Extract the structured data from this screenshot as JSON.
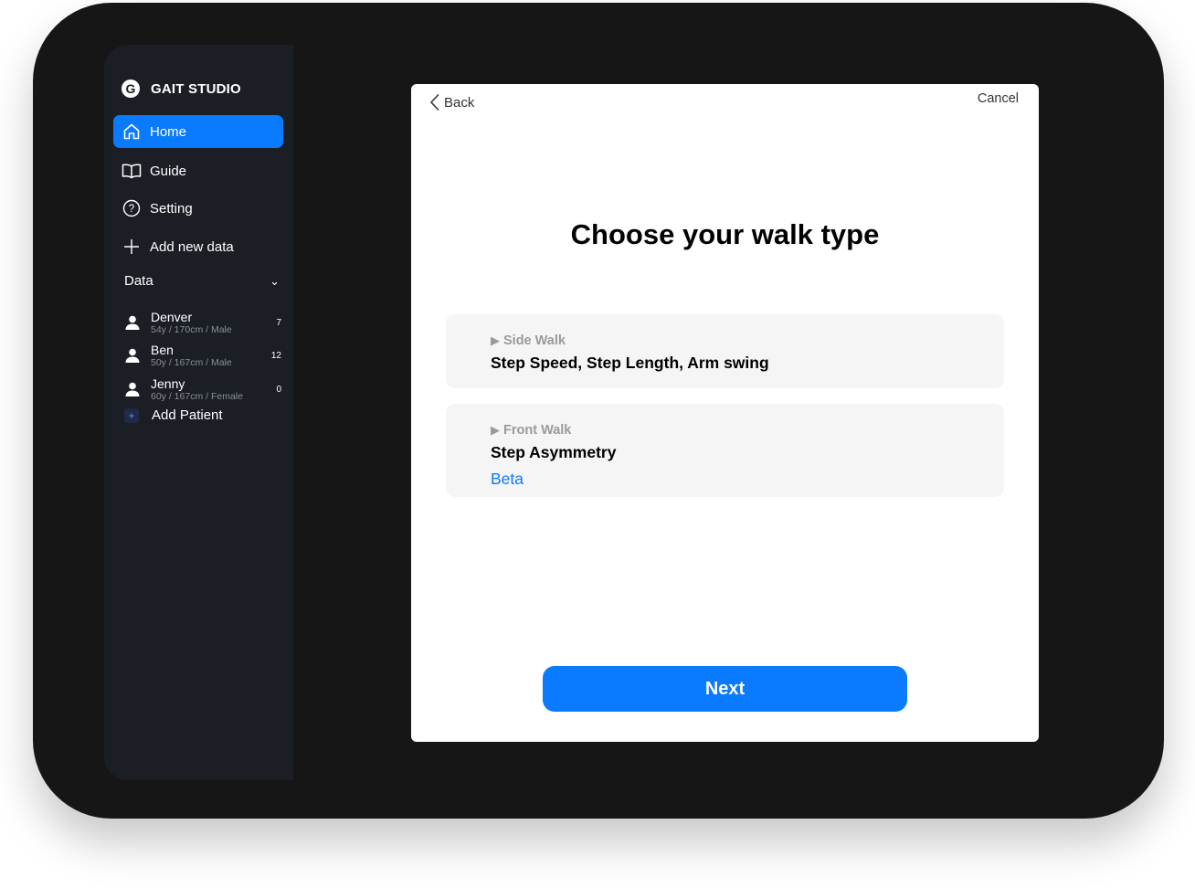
{
  "app": {
    "name": "GAIT STUDIO",
    "logo_letter": "G"
  },
  "sidebar": {
    "items": [
      {
        "label": "Home",
        "icon": "home-icon",
        "active": true
      },
      {
        "label": "Guide",
        "icon": "book-icon",
        "active": false
      },
      {
        "label": "Setting",
        "icon": "question-circle-icon",
        "active": false
      },
      {
        "label": "Add new data",
        "icon": "plus-icon",
        "active": false
      }
    ],
    "data_section": {
      "label": "Data",
      "toggle_glyph": "⌄"
    },
    "patients": [
      {
        "name": "Denver",
        "meta": "54y / 170cm / Male",
        "count": "7"
      },
      {
        "name": "Ben",
        "meta": "50y / 167cm / Male",
        "count": "12"
      },
      {
        "name": "Jenny",
        "meta": "60y / 167cm / Female",
        "count": "0"
      }
    ],
    "add_patient": {
      "label": "Add Patient",
      "glyph": "+"
    }
  },
  "modal": {
    "back_label": "Back",
    "cancel_label": "Cancel",
    "title": "Choose your walk type",
    "options": [
      {
        "type": "Side Walk",
        "title": "Step Speed, Step Length, Arm swing",
        "badge": "",
        "glyph": "▶"
      },
      {
        "type": "Front Walk",
        "title": "Step Asymmetry",
        "badge": "Beta",
        "glyph": "▶"
      }
    ],
    "next_label": "Next"
  },
  "colors": {
    "accent": "#0a7afe",
    "sidebar_bg": "#1b1e25",
    "device_bg": "#161616",
    "option_bg": "#f5f5f6"
  }
}
